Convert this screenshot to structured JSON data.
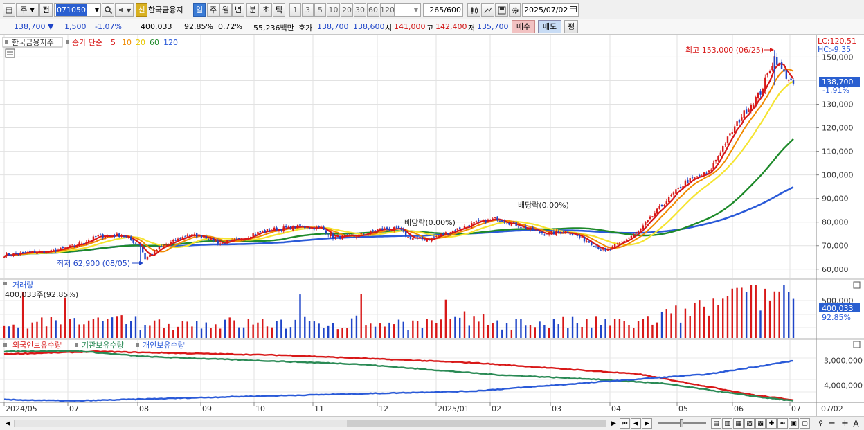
{
  "toolbar": {
    "market_label": "주",
    "prev_label": "전",
    "code": "071050",
    "new_badge": "신",
    "name": "한국금융지",
    "period_buttons": [
      "일",
      "주",
      "월",
      "년",
      "분",
      "초",
      "틱"
    ],
    "active_period": "일",
    "interval_buttons": [
      "1",
      "3",
      "5",
      "10",
      "20",
      "30",
      "60",
      "120"
    ],
    "count": "265",
    "count_max": "/600",
    "date": "2025/07/02"
  },
  "quote": {
    "price": "138,700 ▼",
    "change": "1,500",
    "change_pct": "-1.07%",
    "volume": "400,033",
    "volume_ratio": "92.85%",
    "turnover_rate": "0.72%",
    "amount": "55,236백만",
    "bid_label": "호가",
    "ask": "138,700",
    "bid": "138,600",
    "open_label": "시",
    "open": "141,000",
    "high_label": "고",
    "high": "142,400",
    "low_label": "저",
    "low": "135,700",
    "buy_button": "매수",
    "sell_button": "매도",
    "avg_button": "평"
  },
  "price_pane": {
    "legend_name": "한국금융지주",
    "legend_ma_title": "종가 단순",
    "ma_periods": [
      "5",
      "10",
      "20",
      "60",
      "120"
    ],
    "ma_colors": [
      "#d81818",
      "#f08a00",
      "#f5e430",
      "#1e8a2a",
      "#2a5ad8"
    ],
    "lc_label": "LC:120.51",
    "hc_label": "HC:-9.35",
    "current_price": "138,700",
    "current_change": "-1.91%",
    "high_annotation": "최고 153,000 (06/25)",
    "low_annotation": "최저 62,900 (08/05)",
    "dividend_labels": [
      "배당락(0.00%)",
      "배당락(0.00%)"
    ],
    "y_ticks": [
      "150,000",
      "140,000",
      "130,000",
      "120,000",
      "110,000",
      "100,000",
      "90,000",
      "80,000",
      "70,000",
      "60,000"
    ]
  },
  "volume_pane": {
    "title": "거래량",
    "subtitle": "400,033주(92.85%)",
    "current": "400,033",
    "ratio": "92.85%",
    "y_tick": "500,000"
  },
  "holding_pane": {
    "legend": [
      "외국인보유수량",
      "기관보유수량",
      "개인보유수량"
    ],
    "colors": [
      "#d81818",
      "#2a8a55",
      "#2a5ad8"
    ],
    "y_ticks": [
      "-3,000,000",
      "-4,000,000"
    ]
  },
  "x_axis": {
    "labels": [
      "2024/05",
      "07",
      "08",
      "09",
      "10",
      "11",
      "12",
      "2025/01",
      "02",
      "03",
      "04",
      "05",
      "06",
      "07"
    ],
    "right_label": "07/02"
  },
  "chart_data": {
    "type": "candlestick",
    "symbol": "071050",
    "name": "한국금융지주",
    "yrange": [
      57000,
      156000
    ],
    "anchors": [
      [
        0,
        66000
      ],
      [
        10,
        67000
      ],
      [
        20,
        67500
      ],
      [
        30,
        70000
      ],
      [
        40,
        74000
      ],
      [
        50,
        74500
      ],
      [
        58,
        70000
      ],
      [
        60,
        64500
      ],
      [
        66,
        69000
      ],
      [
        78,
        74500
      ],
      [
        85,
        74000
      ],
      [
        92,
        71000
      ],
      [
        100,
        72500
      ],
      [
        106,
        75000
      ],
      [
        115,
        77000
      ],
      [
        125,
        78000
      ],
      [
        135,
        77500
      ],
      [
        140,
        73500
      ],
      [
        150,
        74000
      ],
      [
        160,
        77000
      ],
      [
        168,
        77000
      ],
      [
        172,
        73500
      ],
      [
        180,
        72500
      ],
      [
        190,
        76000
      ],
      [
        200,
        79500
      ],
      [
        210,
        81500
      ],
      [
        220,
        78000
      ],
      [
        230,
        75000
      ],
      [
        240,
        76000
      ],
      [
        250,
        71000
      ],
      [
        256,
        67500
      ],
      [
        262,
        71000
      ],
      [
        270,
        76000
      ],
      [
        280,
        87000
      ],
      [
        290,
        97000
      ],
      [
        300,
        101000
      ],
      [
        306,
        112000
      ],
      [
        314,
        125000
      ],
      [
        322,
        135000
      ],
      [
        328,
        150000
      ],
      [
        332,
        143000
      ],
      [
        336,
        138700
      ]
    ],
    "volume_range": [
      0,
      560000
    ],
    "holding_range": [
      -4650000,
      -2550000
    ],
    "holding_anchors": {
      "foreign": [
        [
          0,
          -2750000
        ],
        [
          40,
          -2650000
        ],
        [
          120,
          -2800000
        ],
        [
          200,
          -3100000
        ],
        [
          270,
          -3550000
        ],
        [
          320,
          -4400000
        ],
        [
          336,
          -4580000
        ]
      ],
      "institution": [
        [
          0,
          -2650000
        ],
        [
          30,
          -2620000
        ],
        [
          60,
          -2850000
        ],
        [
          150,
          -3150000
        ],
        [
          210,
          -3580000
        ],
        [
          250,
          -3750000
        ],
        [
          280,
          -3920000
        ],
        [
          320,
          -4450000
        ],
        [
          336,
          -4620000
        ]
      ],
      "individual": [
        [
          0,
          -4570000
        ],
        [
          30,
          -4620000
        ],
        [
          100,
          -4450000
        ],
        [
          200,
          -4230000
        ],
        [
          260,
          -3820000
        ],
        [
          300,
          -3550000
        ],
        [
          336,
          -3020000
        ]
      ]
    }
  }
}
